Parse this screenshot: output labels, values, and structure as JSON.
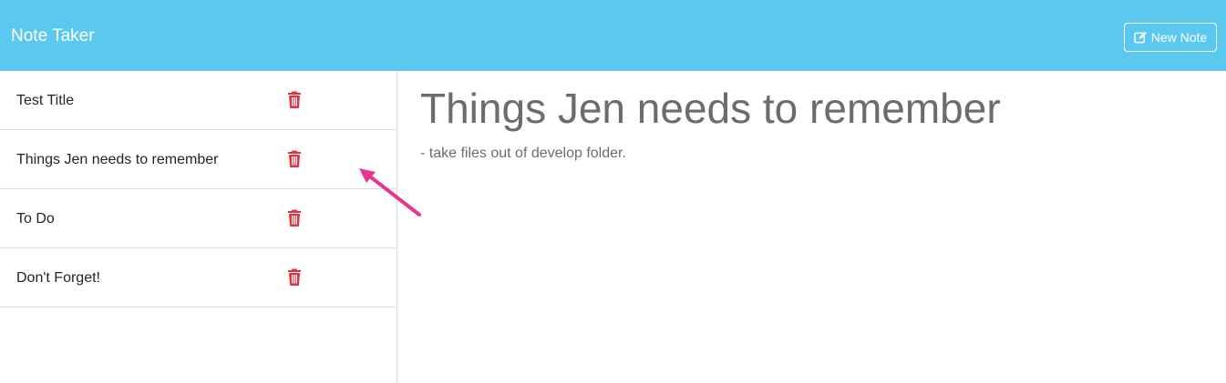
{
  "navbar": {
    "brand": "Note Taker",
    "new_note_label": "New Note",
    "new_note_icon": "edit-icon",
    "background": "#5bc8ee"
  },
  "sidebar": {
    "items": [
      {
        "title": "Test Title",
        "delete_icon": "trash-icon"
      },
      {
        "title": "Things Jen needs to remember",
        "delete_icon": "trash-icon"
      },
      {
        "title": "To Do",
        "delete_icon": "trash-icon"
      },
      {
        "title": "Don't Forget!",
        "delete_icon": "trash-icon"
      }
    ],
    "delete_color": "#dc3545"
  },
  "note": {
    "title": "Things Jen needs to remember",
    "text": "- take files out of develop folder."
  },
  "annotation": {
    "arrow_color": "#e8368f"
  }
}
